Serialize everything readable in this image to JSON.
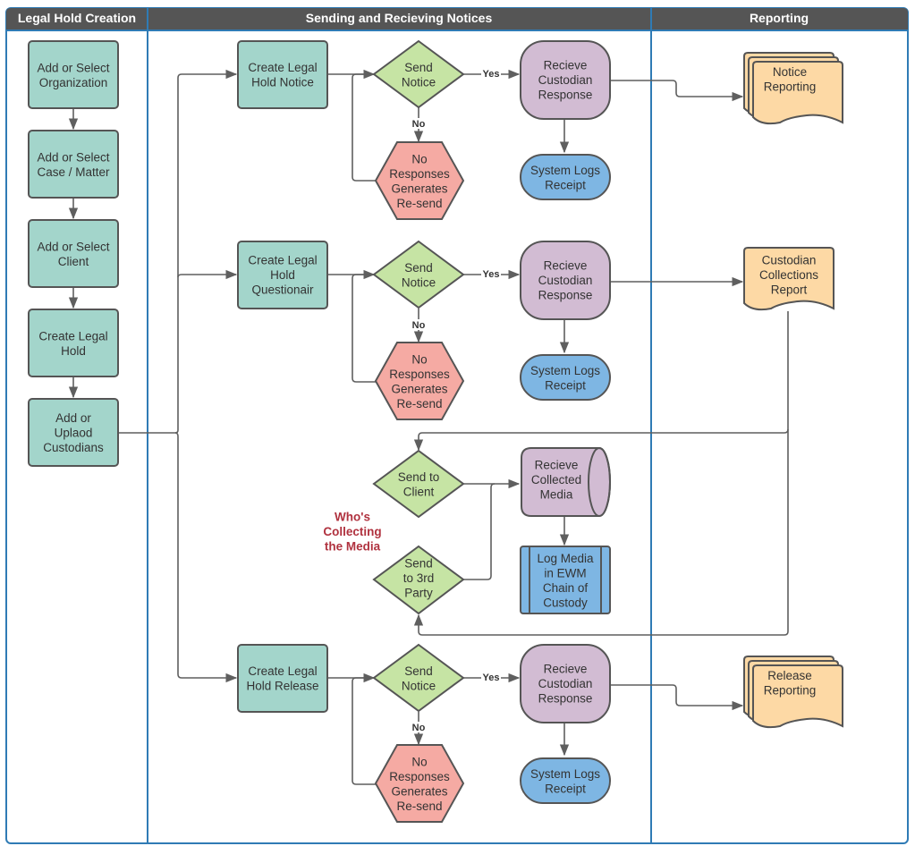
{
  "diagram": {
    "lanes": [
      {
        "id": "creation",
        "title": "Legal Hold Creation"
      },
      {
        "id": "notices",
        "title": "Sending and Recieving Notices"
      },
      {
        "id": "reporting",
        "title": "Reporting"
      }
    ],
    "colors": {
      "header": "#555555",
      "lane_border": "#2f7bb5",
      "process": "#a3d5cb",
      "decision": "#c6e4a4",
      "response": "#d2bcd3",
      "log": "#7eb6e3",
      "resend": "#f5aaa3",
      "report": "#fdd9a5",
      "annotation": "#b0323f"
    },
    "creation": {
      "org": [
        "Add or Select",
        "Organization"
      ],
      "case": [
        "Add or Select",
        "Case / Matter"
      ],
      "client": [
        "Add or Select",
        "Client"
      ],
      "create": [
        "Create Legal",
        "Hold"
      ],
      "custodians": [
        "Add or",
        "Uplaod",
        "Custodians"
      ]
    },
    "flows": [
      {
        "id": "notice",
        "start": [
          "Create Legal",
          "Hold Notice"
        ],
        "decision": [
          "Send",
          "Notice"
        ],
        "yes_label": "Yes",
        "no_label": "No",
        "resend": [
          "No",
          "Responses",
          "Generates",
          "Re-send"
        ],
        "response": [
          "Recieve",
          "Custodian",
          "Response"
        ],
        "log": [
          "System Logs",
          "Receipt"
        ],
        "report": [
          "Notice",
          "Reporting"
        ]
      },
      {
        "id": "questionair",
        "start": [
          "Create Legal",
          "Hold",
          "Questionair"
        ],
        "decision": [
          "Send",
          "Notice"
        ],
        "yes_label": "Yes",
        "no_label": "No",
        "resend": [
          "No",
          "Responses",
          "Generates",
          "Re-send"
        ],
        "response": [
          "Recieve",
          "Custodian",
          "Response"
        ],
        "log": [
          "System Logs",
          "Receipt"
        ],
        "report": [
          "Custodian",
          "Collections",
          "Report"
        ]
      },
      {
        "id": "release",
        "start": [
          "Create Legal",
          "Hold Release"
        ],
        "decision": [
          "Send",
          "Notice"
        ],
        "yes_label": "Yes",
        "no_label": "No",
        "resend": [
          "No",
          "Responses",
          "Generates",
          "Re-send"
        ],
        "response": [
          "Recieve",
          "Custodian",
          "Response"
        ],
        "log": [
          "System Logs",
          "Receipt"
        ],
        "report": [
          "Release",
          "Reporting"
        ]
      }
    ],
    "media": {
      "annotation": [
        "Who's",
        "Collecting",
        "the Media"
      ],
      "client": [
        "Send to",
        "Client"
      ],
      "third_party": [
        "Send",
        "to 3rd",
        "Party"
      ],
      "receive": [
        "Recieve",
        "Collected",
        "Media"
      ],
      "log": [
        "Log Media",
        "in EWM",
        "Chain of",
        "Custody"
      ]
    }
  }
}
